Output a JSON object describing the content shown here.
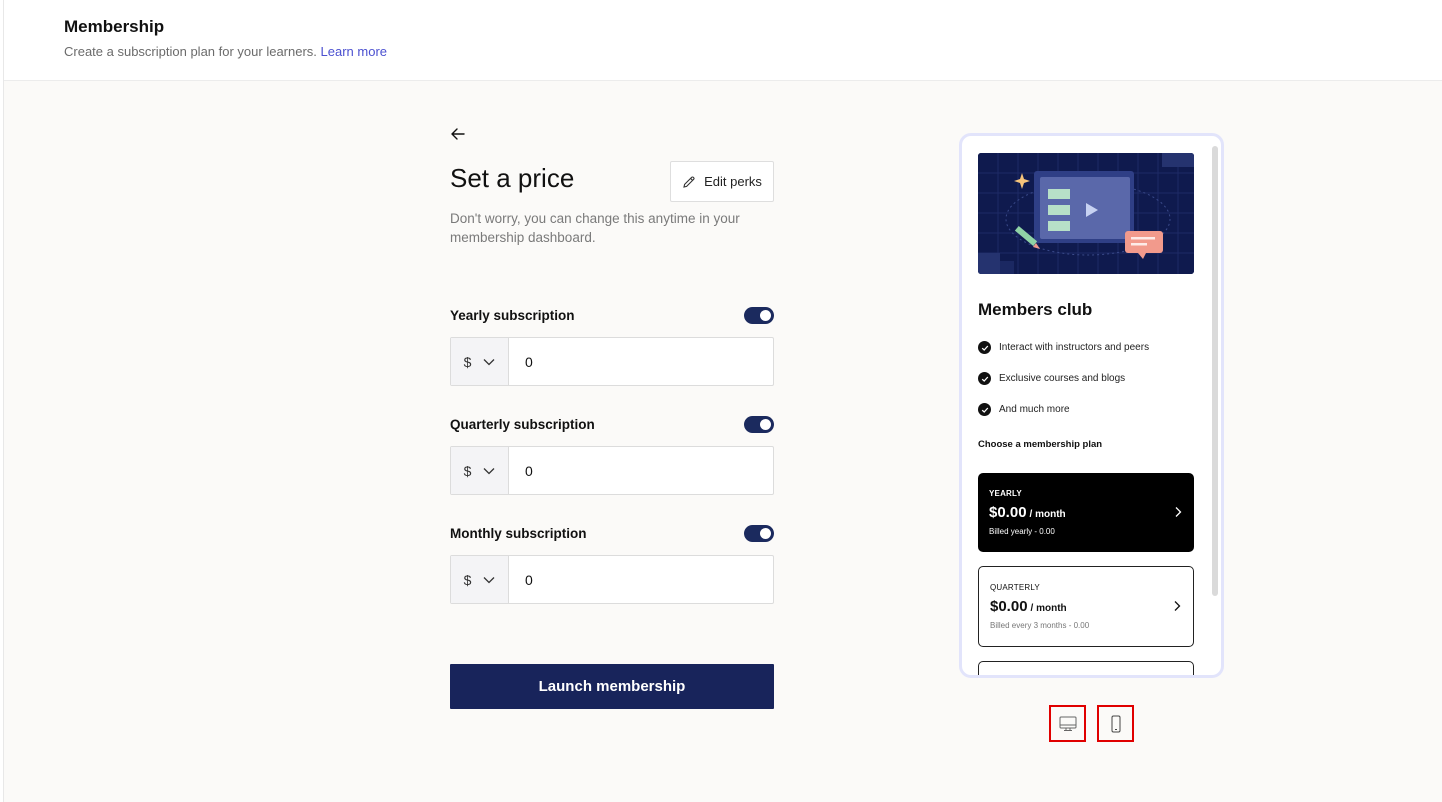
{
  "header": {
    "title": "Membership",
    "subtitle": "Create a subscription plan for your learners.",
    "learn_more": "Learn more"
  },
  "form": {
    "title": "Set a price",
    "edit_perks_label": "Edit perks",
    "helper": "Don't worry, you can change this anytime in your membership dashboard.",
    "subscriptions": [
      {
        "label": "Yearly subscription",
        "enabled": true,
        "currency": "$",
        "value": "0"
      },
      {
        "label": "Quarterly subscription",
        "enabled": true,
        "currency": "$",
        "value": "0"
      },
      {
        "label": "Monthly subscription",
        "enabled": true,
        "currency": "$",
        "value": "0"
      }
    ],
    "launch_label": "Launch membership"
  },
  "preview": {
    "title": "Members club",
    "perks": [
      "Interact with instructors and peers",
      "Exclusive courses and blogs",
      "And much more"
    ],
    "choose_label": "Choose a membership plan",
    "plans": [
      {
        "type": "YEARLY",
        "price": "$0.00",
        "per": "/ month",
        "billing": "Billed yearly - 0.00"
      },
      {
        "type": "QUARTERLY",
        "price": "$0.00",
        "per": "/ month",
        "billing": "Billed every 3 months - 0.00"
      }
    ]
  },
  "device_toggle": {
    "desktop_icon": "monitor-icon",
    "mobile_icon": "smartphone-icon",
    "highlight_color": "#e00000"
  },
  "colors": {
    "primary": "#18245b",
    "link": "#4b50d0",
    "preview_border": "#e2e4fb"
  }
}
